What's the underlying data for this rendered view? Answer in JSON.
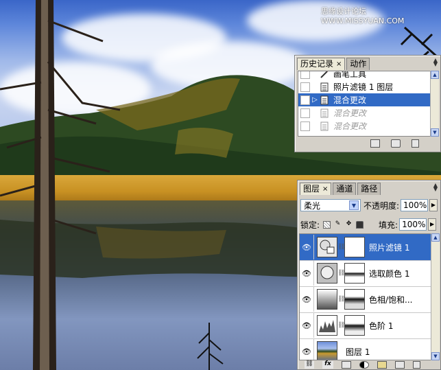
{
  "watermark": "思缘设计论坛 WWW.MISSYUAN.COM",
  "history_panel": {
    "tabs": [
      {
        "label": "历史记录",
        "close": "×"
      },
      {
        "label": "动作"
      }
    ],
    "items": [
      {
        "label": "画笔工具",
        "icon": "brush-icon",
        "state": "normal"
      },
      {
        "label": "照片滤镜 1 图层",
        "icon": "history-state-icon",
        "state": "normal"
      },
      {
        "label": "混合更改",
        "icon": "history-state-icon",
        "state": "selected"
      },
      {
        "label": "混合更改",
        "icon": "history-state-icon",
        "state": "undone"
      },
      {
        "label": "混合更改",
        "icon": "history-state-icon",
        "state": "undone"
      }
    ],
    "footer_icons": [
      "new-document-icon",
      "snapshot-camera-icon",
      "trash-icon"
    ]
  },
  "layers_panel": {
    "tabs": [
      {
        "label": "图层",
        "close": "×"
      },
      {
        "label": "通道"
      },
      {
        "label": "路径"
      }
    ],
    "blend_mode": "柔光",
    "opacity_label": "不透明度:",
    "opacity_value": "100%",
    "lock_label": "锁定:",
    "fill_label": "填充:",
    "fill_value": "100%",
    "layers": [
      {
        "name": "照片滤镜 1",
        "selected": true,
        "thumb": "photo-filter"
      },
      {
        "name": "选取颜色 1",
        "selected": false,
        "thumb": "selective-color"
      },
      {
        "name": "色相/饱和...",
        "selected": false,
        "thumb": "hue-saturation"
      },
      {
        "name": "色阶 1",
        "selected": false,
        "thumb": "levels"
      },
      {
        "name": "图层 1",
        "selected": false,
        "thumb": "image"
      }
    ],
    "footer_icons": [
      "link-icon",
      "fx-icon",
      "mask-icon",
      "adjustment-icon",
      "folder-icon",
      "new-layer-icon",
      "trash-icon"
    ]
  }
}
